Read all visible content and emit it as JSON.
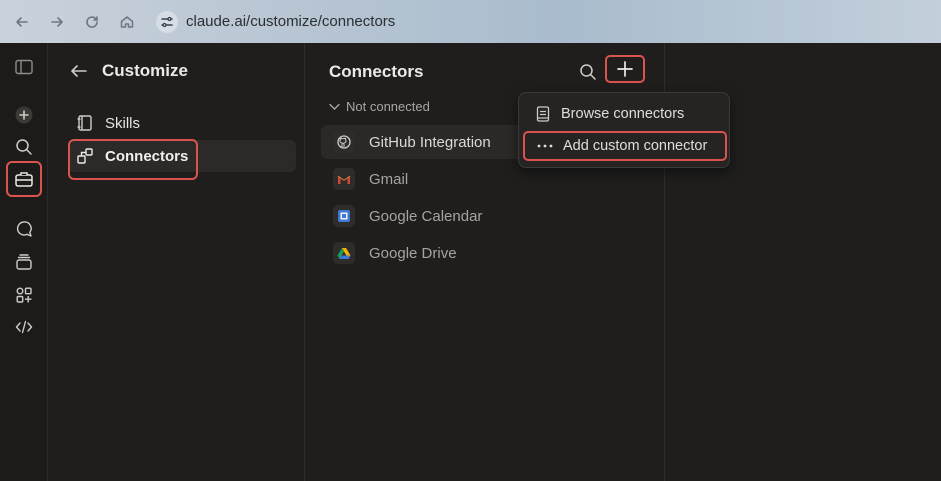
{
  "browser": {
    "url": "claude.ai/customize/connectors"
  },
  "customize": {
    "title": "Customize",
    "items": [
      {
        "label": "Skills"
      },
      {
        "label": "Connectors"
      }
    ]
  },
  "connectors": {
    "title": "Connectors",
    "section_label": "Not connected",
    "items": [
      {
        "label": "GitHub Integration"
      },
      {
        "label": "Gmail"
      },
      {
        "label": "Google Calendar"
      },
      {
        "label": "Google Drive"
      }
    ]
  },
  "dropdown": {
    "items": [
      {
        "label": "Browse connectors"
      },
      {
        "label": "Add custom connector"
      }
    ]
  },
  "colors": {
    "highlight": "#d9534f",
    "background": "#1f1e1d"
  }
}
